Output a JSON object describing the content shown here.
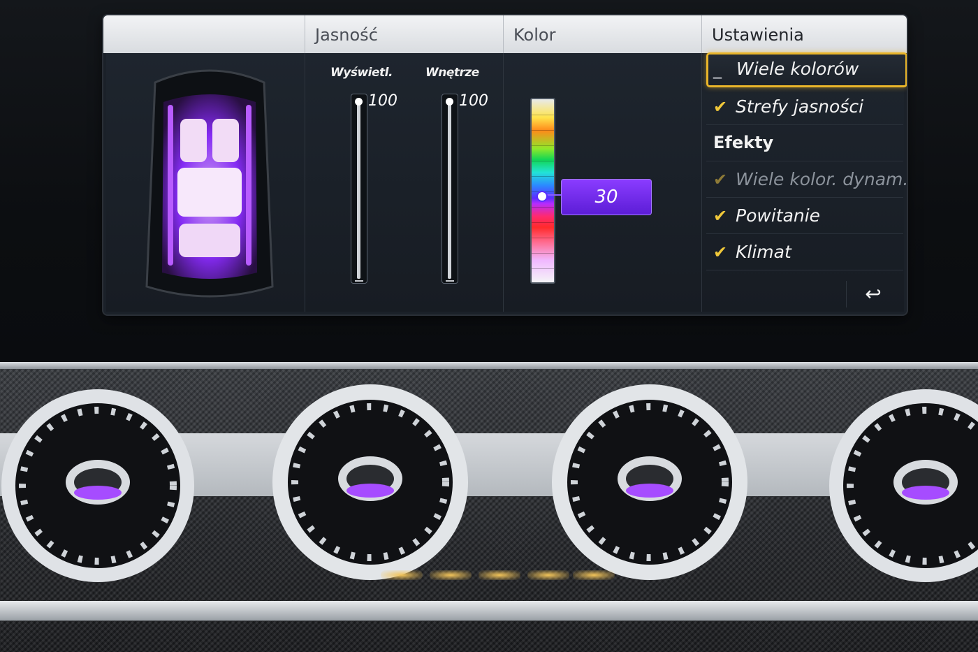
{
  "header": {
    "tabs": [
      {
        "label": ""
      },
      {
        "label": "Jasność"
      },
      {
        "label": "Kolor"
      },
      {
        "label": "Ustawienia"
      }
    ],
    "active_tab": "Ustawienia"
  },
  "brightness": {
    "sliders": [
      {
        "label": "Wyświetl.",
        "value": "100"
      },
      {
        "label": "Wnętrze",
        "value": "100"
      }
    ]
  },
  "color": {
    "value": "30"
  },
  "settings": {
    "items": [
      {
        "label": "Wiele kolorów",
        "checked": false,
        "focused": true
      },
      {
        "label": "Strefy jasności",
        "checked": true
      },
      {
        "label": "Efekty",
        "section": true
      },
      {
        "label": "Wiele kolor. dynam.",
        "checked": true,
        "disabled": true
      },
      {
        "label": "Powitanie",
        "checked": true
      },
      {
        "label": "Klimat",
        "checked": true
      }
    ],
    "check_glyph": "✔",
    "uncheck_glyph": "_"
  },
  "icons": {
    "back": "back-arrow-icon"
  },
  "colors": {
    "accent_focus": "#e9b52a",
    "ambient": "#a04cff",
    "color_value_bg": "#6a24e6"
  }
}
